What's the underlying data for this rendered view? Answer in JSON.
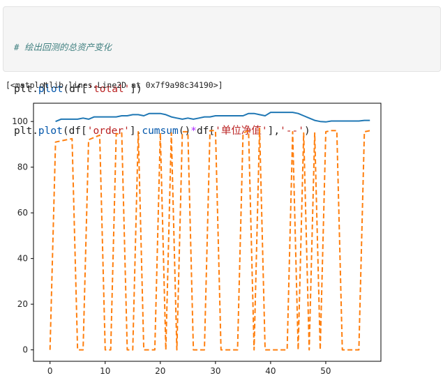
{
  "code_cell": {
    "comment": "# 绘出回测的总资产变化",
    "line1": {
      "prefix": "plt.",
      "fn_a": "p",
      "fn_b": "lot",
      "args_start": "(df[",
      "str": "'total'",
      "args_end": "])"
    },
    "line2": {
      "prefix": "plt.",
      "fn": "plot",
      "a": "(df[",
      "str1": "'order'",
      "b": "].",
      "fn2": "cumsum",
      "c": "()",
      "op": "*",
      "d": "df[",
      "str2": "'单位净值'",
      "e": "],",
      "str3": "'--'",
      "f": ")"
    }
  },
  "output_text": "[<matplotlib.lines.Line2D at 0x7f9a98c34190>]",
  "chart_data": {
    "type": "line",
    "title": "",
    "xlabel": "",
    "ylabel": "",
    "xlim": [
      -3,
      60
    ],
    "ylim": [
      -5,
      108
    ],
    "x_ticks": [
      0,
      10,
      20,
      30,
      40,
      50
    ],
    "y_ticks": [
      0,
      20,
      40,
      60,
      80,
      100
    ],
    "x_tick_labels": [
      "0",
      "10",
      "20",
      "30",
      "40",
      "50"
    ],
    "y_tick_labels": [
      "0",
      "20",
      "40",
      "60",
      "80",
      "100"
    ],
    "grid": false,
    "series": [
      {
        "color": "#1f77b4",
        "style": "solid",
        "x": [
          1,
          2,
          3,
          4,
          5,
          6,
          7,
          8,
          9,
          10,
          11,
          12,
          13,
          14,
          15,
          16,
          17,
          18,
          19,
          20,
          21,
          22,
          23,
          24,
          25,
          26,
          27,
          28,
          29,
          30,
          31,
          32,
          33,
          34,
          35,
          36,
          37,
          38,
          39,
          40,
          41,
          42,
          43,
          44,
          45,
          46,
          47,
          48,
          49,
          50,
          51,
          52,
          53,
          54,
          55,
          56,
          57,
          58
        ],
        "values": [
          100,
          101,
          101,
          101,
          101,
          101.5,
          101,
          102,
          102,
          102,
          102,
          102,
          102.5,
          102.5,
          103,
          103,
          102.5,
          103.5,
          103.5,
          103.5,
          103,
          102,
          101.5,
          101,
          101.5,
          101,
          101.5,
          102,
          102,
          102.5,
          102.5,
          102.5,
          102.5,
          102.5,
          102.5,
          103.5,
          103.5,
          103,
          102.5,
          104,
          104,
          104,
          104,
          104,
          103.5,
          102.5,
          101.5,
          100.5,
          100,
          99.8,
          100.2,
          100.2,
          100.2,
          100.2,
          100.2,
          100.2,
          100.5,
          100.5
        ]
      },
      {
        "color": "#ff7f0e",
        "style": "dashed",
        "x": [
          0,
          1,
          2,
          3,
          4,
          5,
          6,
          7,
          8,
          9,
          10,
          11,
          12,
          13,
          14,
          15,
          16,
          17,
          18,
          19,
          20,
          21,
          22,
          23,
          24,
          25,
          26,
          27,
          28,
          29,
          30,
          31,
          32,
          33,
          34,
          35,
          36,
          37,
          38,
          39,
          40,
          41,
          42,
          43,
          44,
          45,
          46,
          47,
          48,
          49,
          50,
          51,
          52,
          53,
          54,
          55,
          56,
          57,
          58
        ],
        "values": [
          0,
          91,
          91.5,
          92,
          92.5,
          0,
          0,
          92,
          93,
          94,
          0,
          0,
          94.5,
          95,
          0,
          0,
          95.5,
          0,
          0,
          0,
          95,
          0,
          95,
          0,
          95.5,
          95.5,
          0,
          0,
          0,
          96,
          96,
          0,
          0,
          0,
          0,
          95,
          96,
          0,
          97,
          0,
          0,
          0,
          0,
          0,
          95.5,
          0,
          95,
          0,
          95,
          0,
          95.5,
          96,
          96,
          0,
          0,
          0,
          0,
          95.5,
          96
        ]
      }
    ]
  }
}
